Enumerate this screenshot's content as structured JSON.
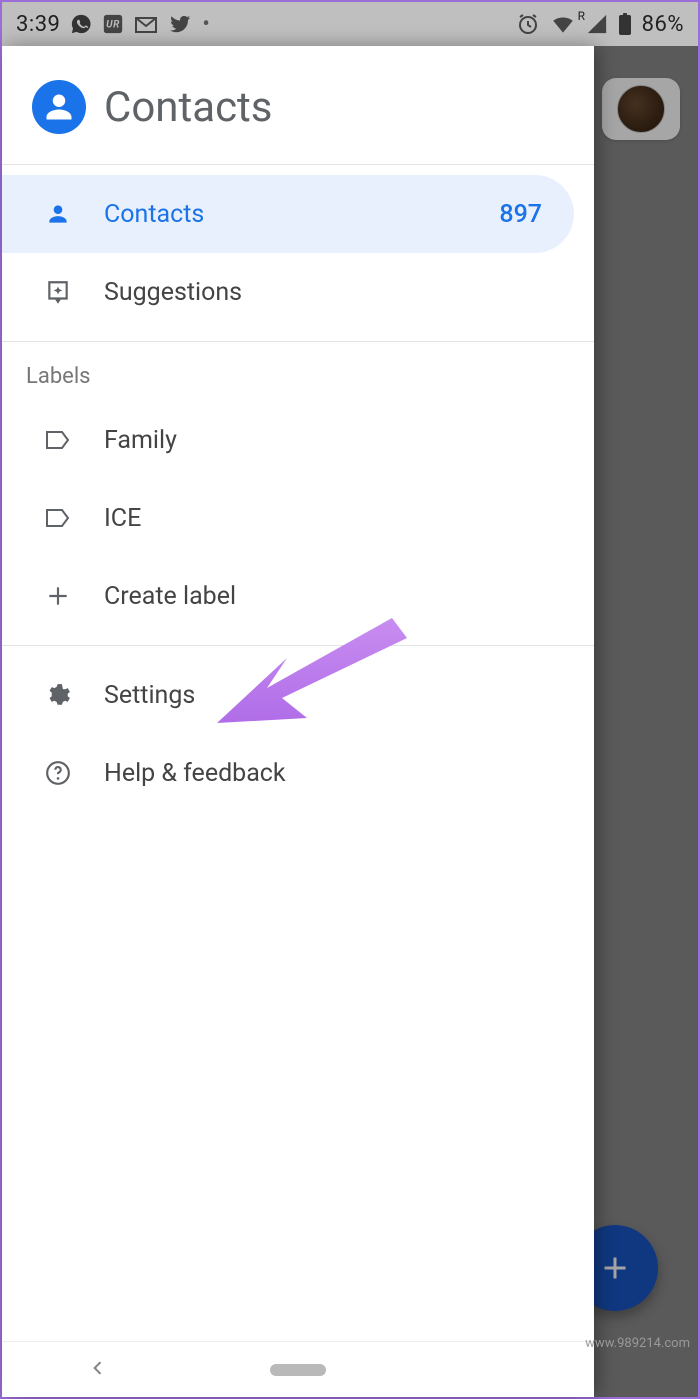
{
  "statusbar": {
    "time": "3:39",
    "battery": "86%",
    "signal_label": "R"
  },
  "drawer": {
    "title": "Contacts",
    "nav": {
      "contacts": {
        "label": "Contacts",
        "count": "897"
      },
      "suggestions": {
        "label": "Suggestions"
      }
    },
    "labels_section": "Labels",
    "labels": [
      {
        "label": "Family"
      },
      {
        "label": "ICE"
      }
    ],
    "create_label": "Create label",
    "settings": "Settings",
    "help": "Help & feedback"
  },
  "fab": {
    "glyph": "+"
  },
  "watermark": "www.989214.com"
}
